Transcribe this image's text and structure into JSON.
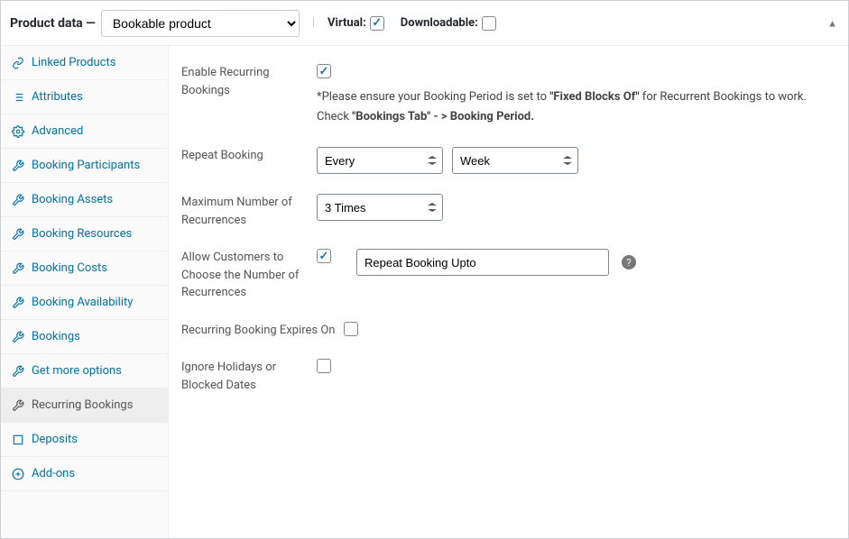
{
  "header": {
    "title": "Product data —",
    "product_type": "Bookable product",
    "virtual_label": "Virtual:",
    "virtual_checked": true,
    "downloadable_label": "Downloadable:",
    "downloadable_checked": false
  },
  "sidebar": [
    {
      "slug": "linked-products",
      "label": "Linked Products",
      "icon": "link"
    },
    {
      "slug": "attributes",
      "label": "Attributes",
      "icon": "list"
    },
    {
      "slug": "advanced",
      "label": "Advanced",
      "icon": "gear"
    },
    {
      "slug": "booking-participants",
      "label": "Booking Participants",
      "icon": "wrench"
    },
    {
      "slug": "booking-assets",
      "label": "Booking Assets",
      "icon": "wrench"
    },
    {
      "slug": "booking-resources",
      "label": "Booking Resources",
      "icon": "wrench"
    },
    {
      "slug": "booking-costs",
      "label": "Booking Costs",
      "icon": "wrench"
    },
    {
      "slug": "booking-availability",
      "label": "Booking Availability",
      "icon": "wrench"
    },
    {
      "slug": "bookings",
      "label": "Bookings",
      "icon": "wrench"
    },
    {
      "slug": "get-more-options",
      "label": "Get more options",
      "icon": "wrench"
    },
    {
      "slug": "recurring-bookings",
      "label": "Recurring Bookings",
      "icon": "wrench",
      "active": true
    },
    {
      "slug": "deposits",
      "label": "Deposits",
      "icon": "square"
    },
    {
      "slug": "add-ons",
      "label": "Add-ons",
      "icon": "plus"
    }
  ],
  "form": {
    "enable": {
      "label": "Enable Recurring Bookings",
      "checked": true,
      "note_prefix": "*Please ensure your Booking Period is set to ",
      "note_bold1": "\"Fixed Blocks Of\"",
      "note_mid": " for Recurrent Bookings to work. Check ",
      "note_bold2": "\"Bookings Tab\" - > Booking Period."
    },
    "repeat": {
      "label": "Repeat Booking",
      "freq": "Every",
      "unit": "Week"
    },
    "max_recur": {
      "label": "Maximum Number of Recurrences",
      "value": "3 Times"
    },
    "allow_choose": {
      "label": "Allow Customers to Choose the Number of Recurrences",
      "checked": true,
      "input_value": "Repeat Booking Upto"
    },
    "expires": {
      "label": "Recurring Booking Expires On",
      "checked": false
    },
    "ignore": {
      "label": "Ignore Holidays or Blocked Dates",
      "checked": false
    }
  }
}
